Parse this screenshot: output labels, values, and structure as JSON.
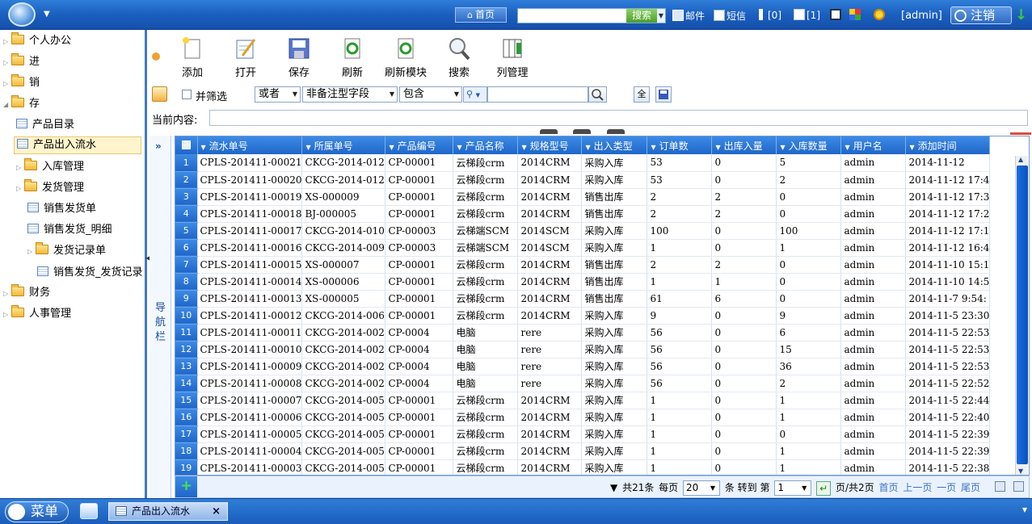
{
  "header": {
    "home_label": "首页",
    "search_button": "搜索",
    "mail_label": "邮件",
    "sms_label": "短信",
    "sound_count": "[0]",
    "doc_count": "[1]",
    "user": "[admin]",
    "logout_label": "注销"
  },
  "sidebar": {
    "items": [
      {
        "label": "个人办公"
      },
      {
        "label": "进"
      },
      {
        "label": "销"
      },
      {
        "label": "存"
      },
      {
        "label": "产品目录"
      },
      {
        "label": "产品出入流水"
      },
      {
        "label": "入库管理"
      },
      {
        "label": "发货管理"
      },
      {
        "label": "销售发货单"
      },
      {
        "label": "销售发货_明细"
      },
      {
        "label": "发货记录单"
      },
      {
        "label": "销售发货_发货记录"
      },
      {
        "label": "财务"
      },
      {
        "label": "人事管理"
      }
    ]
  },
  "toolbar": {
    "add": "添加",
    "open": "打开",
    "save": "保存",
    "refresh": "刷新",
    "refresh_module": "刷新模块",
    "search": "搜索",
    "columns": "列管理"
  },
  "filter": {
    "combine_label": "并筛选",
    "logic": "或者",
    "field": "非备注型字段",
    "operator": "包含",
    "all_button": "全",
    "current_label": "当前内容:"
  },
  "nav_strip": {
    "label": "导航栏"
  },
  "grid": {
    "columns": [
      "流水单号",
      "所属单号",
      "产品编号",
      "产品名称",
      "规格型号",
      "出入类型",
      "订单数",
      "出库入量",
      "入库数量",
      "用户名",
      "添加时间"
    ],
    "rows": [
      [
        "1",
        "CPLS-201411-00021",
        "CKCG-2014-012",
        "CP-00001",
        "云梯段crm",
        "2014CRM",
        "采购入库",
        "53",
        "0",
        "5",
        "admin",
        "2014-11-12"
      ],
      [
        "2",
        "CPLS-201411-00020",
        "CKCG-2014-012",
        "CP-00001",
        "云梯段crm",
        "2014CRM",
        "采购入库",
        "53",
        "0",
        "2",
        "admin",
        "2014-11-12 17:4"
      ],
      [
        "3",
        "CPLS-201411-00019",
        "XS-000009",
        "CP-00001",
        "云梯段crm",
        "2014CRM",
        "销售出库",
        "2",
        "2",
        "0",
        "admin",
        "2014-11-12 17:3"
      ],
      [
        "4",
        "CPLS-201411-00018",
        "BJ-000005",
        "CP-00001",
        "云梯段crm",
        "2014CRM",
        "销售出库",
        "2",
        "2",
        "0",
        "admin",
        "2014-11-12 17:2"
      ],
      [
        "5",
        "CPLS-201411-00017",
        "CKCG-2014-010",
        "CP-00003",
        "云梯端SCM",
        "2014SCM",
        "采购入库",
        "100",
        "0",
        "100",
        "admin",
        "2014-11-12 17:1"
      ],
      [
        "6",
        "CPLS-201411-00016",
        "CKCG-2014-009",
        "CP-00003",
        "云梯端SCM",
        "2014SCM",
        "采购入库",
        "1",
        "0",
        "1",
        "admin",
        "2014-11-12 16:4"
      ],
      [
        "7",
        "CPLS-201411-00015",
        "XS-000007",
        "CP-00001",
        "云梯段crm",
        "2014CRM",
        "销售出库",
        "2",
        "2",
        "0",
        "admin",
        "2014-11-10 15:1"
      ],
      [
        "8",
        "CPLS-201411-00014",
        "XS-000006",
        "CP-00001",
        "云梯段crm",
        "2014CRM",
        "销售出库",
        "1",
        "1",
        "0",
        "admin",
        "2014-11-10 14:5"
      ],
      [
        "9",
        "CPLS-201411-00013",
        "XS-000005",
        "CP-00001",
        "云梯段crm",
        "2014CRM",
        "销售出库",
        "61",
        "6",
        "0",
        "admin",
        "2014-11-7 9:54:"
      ],
      [
        "10",
        "CPLS-201411-00012",
        "CKCG-2014-006",
        "CP-00001",
        "云梯段crm",
        "2014CRM",
        "采购入库",
        "9",
        "0",
        "9",
        "admin",
        "2014-11-5 23:30"
      ],
      [
        "11",
        "CPLS-201411-00011",
        "CKCG-2014-002",
        "CP-0004",
        "电脑",
        "rere",
        "采购入库",
        "56",
        "0",
        "6",
        "admin",
        "2014-11-5 22:53"
      ],
      [
        "12",
        "CPLS-201411-00010",
        "CKCG-2014-002",
        "CP-0004",
        "电脑",
        "rere",
        "采购入库",
        "56",
        "0",
        "15",
        "admin",
        "2014-11-5 22:53"
      ],
      [
        "13",
        "CPLS-201411-00009",
        "CKCG-2014-002",
        "CP-0004",
        "电脑",
        "rere",
        "采购入库",
        "56",
        "0",
        "36",
        "admin",
        "2014-11-5 22:53"
      ],
      [
        "14",
        "CPLS-201411-00008",
        "CKCG-2014-002",
        "CP-0004",
        "电脑",
        "rere",
        "采购入库",
        "56",
        "0",
        "2",
        "admin",
        "2014-11-5 22:52"
      ],
      [
        "15",
        "CPLS-201411-00007",
        "CKCG-2014-005",
        "CP-00001",
        "云梯段crm",
        "2014CRM",
        "采购入库",
        "1",
        "0",
        "1",
        "admin",
        "2014-11-5 22:44"
      ],
      [
        "16",
        "CPLS-201411-00006",
        "CKCG-2014-005",
        "CP-00001",
        "云梯段crm",
        "2014CRM",
        "采购入库",
        "1",
        "0",
        "1",
        "admin",
        "2014-11-5 22:40"
      ],
      [
        "17",
        "CPLS-201411-00005",
        "CKCG-2014-005",
        "CP-00001",
        "云梯段crm",
        "2014CRM",
        "采购入库",
        "1",
        "0",
        "0",
        "admin",
        "2014-11-5 22:39"
      ],
      [
        "18",
        "CPLS-201411-00004",
        "CKCG-2014-005",
        "CP-00001",
        "云梯段crm",
        "2014CRM",
        "采购入库",
        "1",
        "0",
        "1",
        "admin",
        "2014-11-5 22:39"
      ],
      [
        "19",
        "CPLS-201411-00003",
        "CKCG-2014-005",
        "CP-00001",
        "云梯段crm",
        "2014CRM",
        "采购入库",
        "1",
        "0",
        "1",
        "admin",
        "2014-11-5 22:38"
      ]
    ]
  },
  "pager": {
    "total": "共21条",
    "per_page_label": "每页",
    "per_page": "20",
    "goto_label": "条 转到 第",
    "page": "1",
    "pages": "页/共2页",
    "first": "首页",
    "prev": "上一页",
    "next": "一页",
    "last": "尾页"
  },
  "taskbar": {
    "menu_label": "菜单",
    "task_label": "产品出入流水",
    "close": "×"
  }
}
